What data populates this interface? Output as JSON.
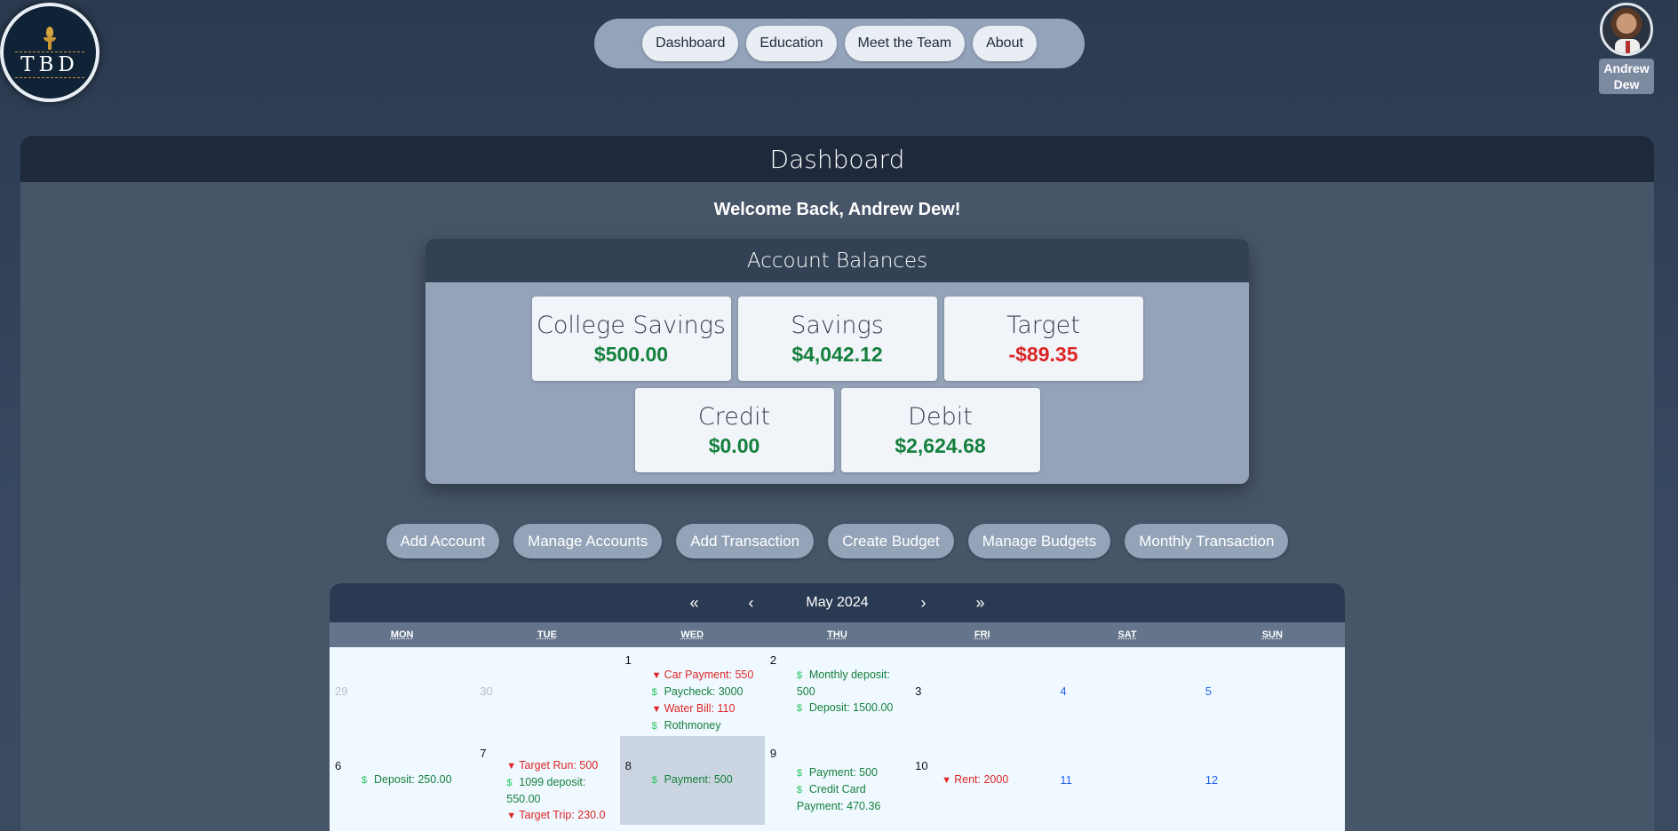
{
  "logo": {
    "text": "TBD"
  },
  "nav": {
    "items": [
      {
        "label": "Dashboard"
      },
      {
        "label": "Education"
      },
      {
        "label": "Meet the Team"
      },
      {
        "label": "About"
      }
    ]
  },
  "user": {
    "first_name": "Andrew",
    "last_name": "Dew"
  },
  "page": {
    "title": "Dashboard",
    "welcome": "Welcome Back, Andrew Dew!"
  },
  "balances": {
    "title": "Account Balances",
    "accounts": [
      {
        "name": "College Savings",
        "amount": "$500.00",
        "status": "positive"
      },
      {
        "name": "Savings",
        "amount": "$4,042.12",
        "status": "positive"
      },
      {
        "name": "Target",
        "amount": "-$89.35",
        "status": "negative"
      },
      {
        "name": "Credit",
        "amount": "$0.00",
        "status": "positive"
      },
      {
        "name": "Debit",
        "amount": "$2,624.68",
        "status": "positive"
      }
    ],
    "colors": {
      "positive": "#15803d",
      "negative": "#dc2626"
    }
  },
  "actions": [
    {
      "label": "Add Account"
    },
    {
      "label": "Manage Accounts"
    },
    {
      "label": "Add Transaction"
    },
    {
      "label": "Create Budget"
    },
    {
      "label": "Manage Budgets"
    },
    {
      "label": "Monthly Transaction"
    }
  ],
  "calendar": {
    "month_label": "May 2024",
    "nav": {
      "prev_year": "«",
      "prev_month": "‹",
      "next_month": "›",
      "next_year": "»"
    },
    "weekdays": [
      "MON",
      "TUE",
      "WED",
      "THU",
      "FRI",
      "SAT",
      "SUN"
    ],
    "weeks": [
      [
        {
          "day": "29",
          "muted": true,
          "events": []
        },
        {
          "day": "30",
          "muted": true,
          "events": []
        },
        {
          "day": "1",
          "events": [
            {
              "type": "out",
              "text": "Car Payment: 550"
            },
            {
              "type": "in",
              "text": "Paycheck: 3000"
            },
            {
              "type": "out",
              "text": "Water Bill: 110"
            },
            {
              "type": "in",
              "text": "Rothmoney"
            }
          ]
        },
        {
          "day": "2",
          "events": [
            {
              "type": "in",
              "text": "Monthly deposit: 500"
            },
            {
              "type": "in",
              "text": "Deposit: 1500.00"
            }
          ]
        },
        {
          "day": "3",
          "events": []
        },
        {
          "day": "4",
          "weekend": true,
          "events": []
        },
        {
          "day": "5",
          "weekend": true,
          "events": []
        }
      ],
      [
        {
          "day": "6",
          "events": [
            {
              "type": "in",
              "text": "Deposit: 250.00"
            }
          ]
        },
        {
          "day": "7",
          "events": [
            {
              "type": "out",
              "text": "Target Run: 500"
            },
            {
              "type": "in",
              "text": "1099 deposit: 550.00"
            },
            {
              "type": "out",
              "text": "Target Trip: 230.0"
            }
          ]
        },
        {
          "day": "8",
          "selected": true,
          "events": [
            {
              "type": "in",
              "text": "Payment: 500"
            }
          ]
        },
        {
          "day": "9",
          "events": [
            {
              "type": "in",
              "text": "Payment: 500"
            },
            {
              "type": "in",
              "text": "Credit Card Payment: 470.36"
            }
          ]
        },
        {
          "day": "10",
          "events": [
            {
              "type": "out",
              "text": "Rent: 2000"
            }
          ]
        },
        {
          "day": "11",
          "weekend": true,
          "events": []
        },
        {
          "day": "12",
          "weekend": true,
          "events": []
        }
      ]
    ],
    "icons": {
      "in": "dollar-icon",
      "out": "down-triangle-icon"
    }
  }
}
